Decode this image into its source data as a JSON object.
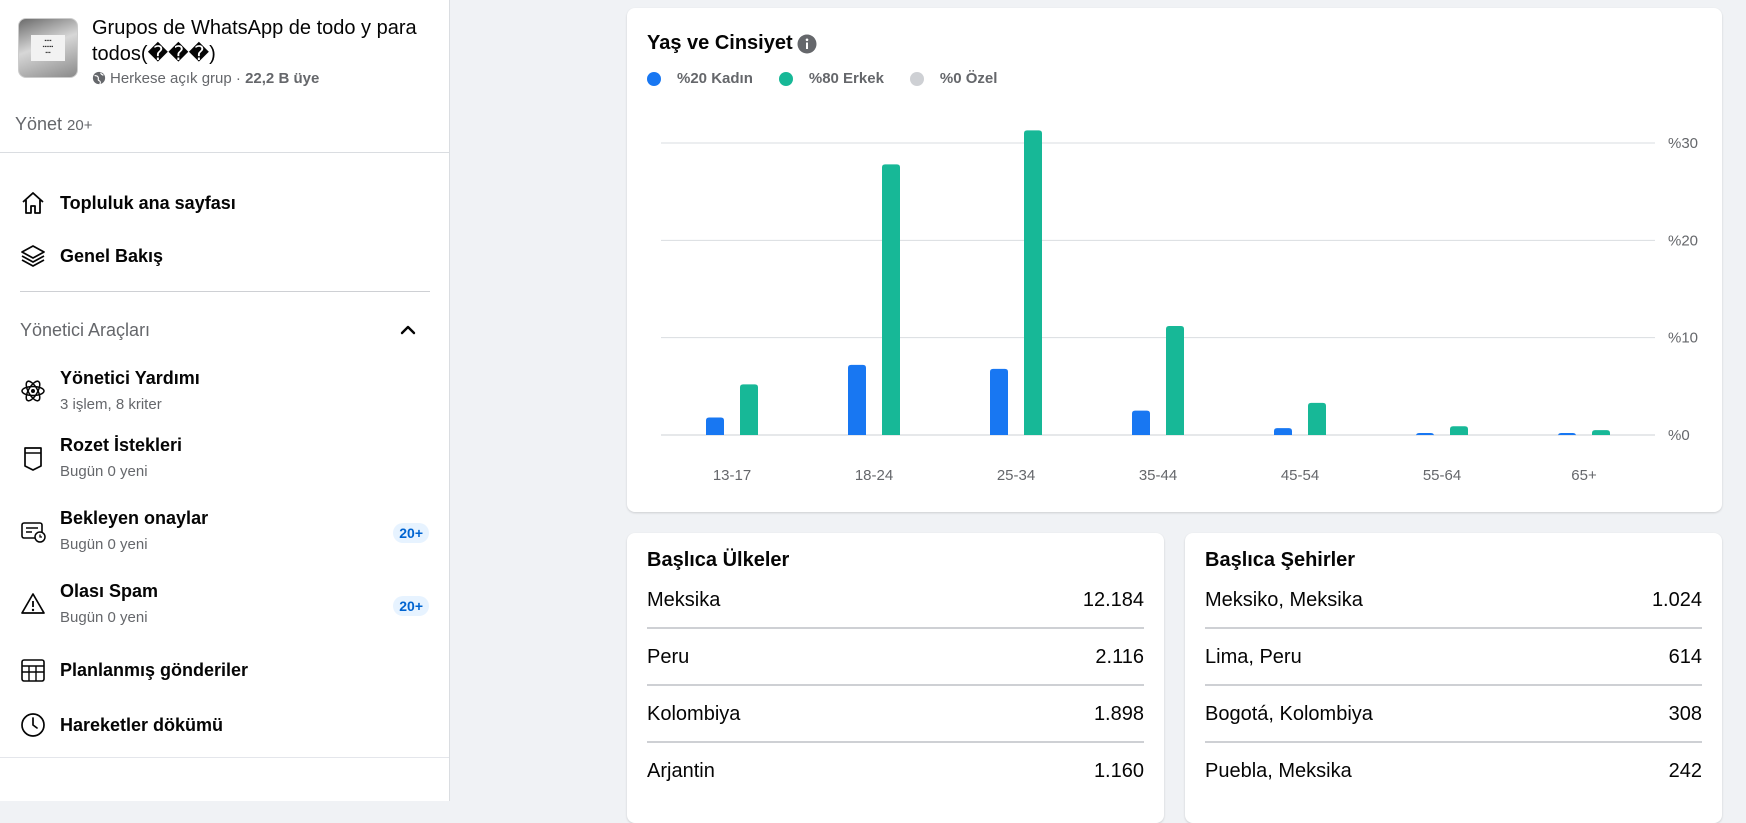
{
  "group": {
    "name": "Grupos de WhatsApp de todo y para todos(���)",
    "privacy": "Herkese açık grup",
    "members": "22,2 B üye"
  },
  "sidebar": {
    "manage_label": "Yönet",
    "manage_count": "20+",
    "nav": [
      {
        "label": "Topluluk ana sayfası",
        "icon": "home-icon"
      },
      {
        "label": "Genel Bakış",
        "icon": "layers-icon"
      }
    ],
    "admin_tools_title": "Yönetici Araçları",
    "tools": [
      {
        "title": "Yönetici Yardımı",
        "sub": "3 işlem, 8 kriter",
        "badge": "",
        "icon": "atom-icon"
      },
      {
        "title": "Rozet İstekleri",
        "sub": "Bugün 0 yeni",
        "badge": "",
        "icon": "badge-icon"
      },
      {
        "title": "Bekleyen onaylar",
        "sub": "Bugün 0 yeni",
        "badge": "20+",
        "icon": "pending-icon"
      },
      {
        "title": "Olası Spam",
        "sub": "Bugün 0 yeni",
        "badge": "20+",
        "icon": "warning-icon"
      }
    ],
    "tools_simple": [
      {
        "label": "Planlanmış gönderiler",
        "icon": "calendar-icon"
      },
      {
        "label": "Hareketler dökümü",
        "icon": "clock-icon"
      }
    ]
  },
  "colors": {
    "kadin": "#1877f2",
    "erkek": "#17b897",
    "ozel": "#ced0d4"
  },
  "chart_data": {
    "type": "bar",
    "title": "Yaş ve Cinsiyet",
    "legend": [
      "%20 Kadın",
      "%80 Erkek",
      "%0 Özel"
    ],
    "categories": [
      "13-17",
      "18-24",
      "25-34",
      "35-44",
      "45-54",
      "55-64",
      "65+"
    ],
    "series": [
      {
        "name": "Kadın",
        "values": [
          1.8,
          7.2,
          6.8,
          2.5,
          0.7,
          0.2,
          0.2
        ]
      },
      {
        "name": "Erkek",
        "values": [
          5.2,
          27.8,
          31.3,
          11.2,
          3.3,
          0.9,
          0.5
        ]
      }
    ],
    "yticks": [
      "%0",
      "%10",
      "%20",
      "%30"
    ],
    "ylim": [
      0,
      30
    ]
  },
  "countries": {
    "title": "Başlıca Ülkeler",
    "rows": [
      {
        "name": "Meksika",
        "value": "12.184"
      },
      {
        "name": "Peru",
        "value": "2.116"
      },
      {
        "name": "Kolombiya",
        "value": "1.898"
      },
      {
        "name": "Arjantin",
        "value": "1.160"
      }
    ]
  },
  "cities": {
    "title": "Başlıca Şehirler",
    "rows": [
      {
        "name": "Meksiko, Meksika",
        "value": "1.024"
      },
      {
        "name": "Lima, Peru",
        "value": "614"
      },
      {
        "name": "Bogotá, Kolombiya",
        "value": "308"
      },
      {
        "name": "Puebla, Meksika",
        "value": "242"
      }
    ]
  }
}
